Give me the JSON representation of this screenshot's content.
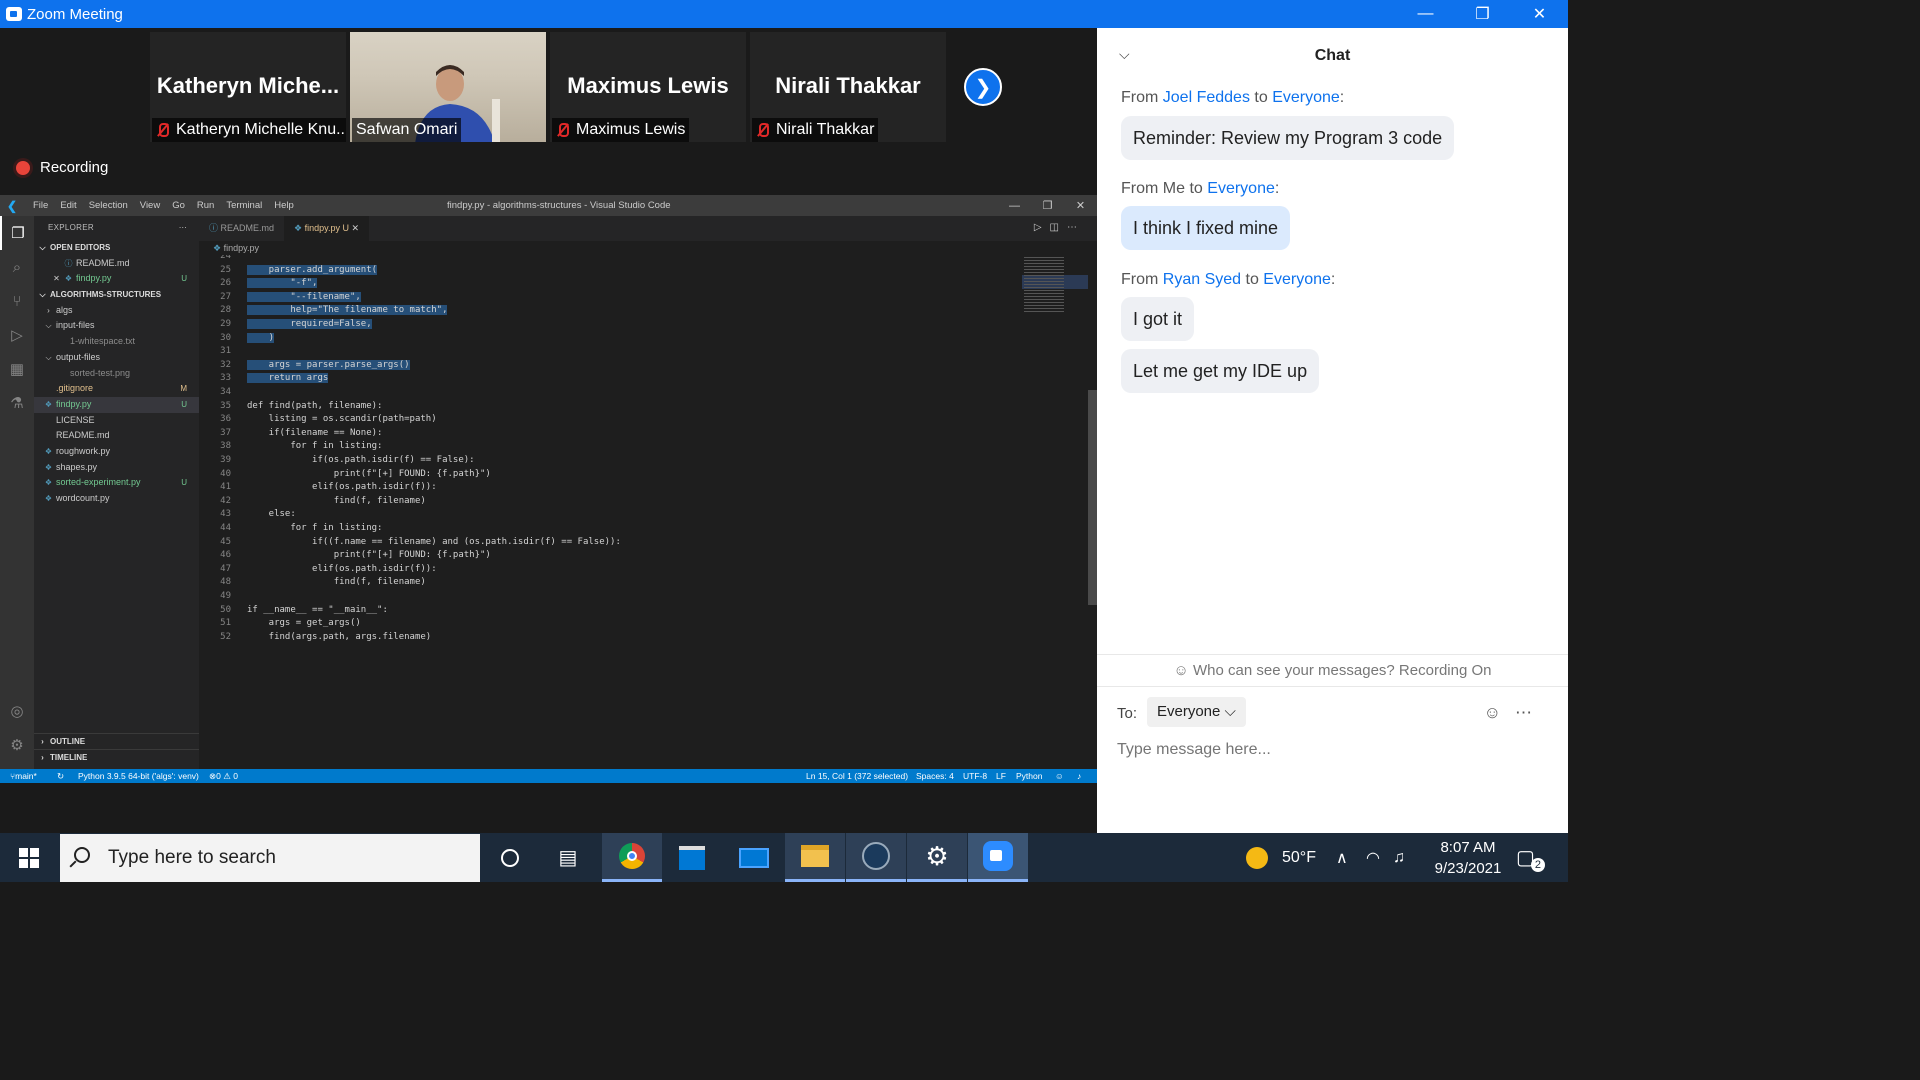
{
  "window": {
    "title": "Zoom Meeting"
  },
  "gallery": {
    "tiles": [
      {
        "big": "Katheryn  Miche...",
        "name": "Katheryn Michelle Knu..."
      },
      {
        "big": "",
        "name": "Safwan Omari"
      },
      {
        "big": "Maximus Lewis",
        "name": "Maximus Lewis"
      },
      {
        "big": "Nirali Thakkar",
        "name": "Nirali Thakkar"
      }
    ],
    "recording": "Recording"
  },
  "vscode": {
    "menu": [
      "File",
      "Edit",
      "Selection",
      "View",
      "Go",
      "Run",
      "Terminal",
      "Help"
    ],
    "title": "findpy.py - algorithms-structures - Visual Studio Code",
    "explorer_title": "EXPLORER",
    "open_editors": "OPEN EDITORS",
    "project": "ALGORITHMS-STRUCTURES",
    "outline": "OUTLINE",
    "timeline": "TIMELINE",
    "open_files": [
      {
        "name": "README.md",
        "status": ""
      },
      {
        "name": "findpy.py",
        "status": "U"
      }
    ],
    "files": [
      {
        "name": "algs",
        "status": "",
        "indent": 1,
        "type": "folder-closed"
      },
      {
        "name": "input-files",
        "status": "",
        "indent": 1,
        "type": "folder-open"
      },
      {
        "name": "1-whitespace.txt",
        "status": "",
        "indent": 2,
        "type": "file"
      },
      {
        "name": "output-files",
        "status": "",
        "indent": 1,
        "type": "folder-open"
      },
      {
        "name": "sorted-test.png",
        "status": "",
        "indent": 2,
        "type": "file"
      },
      {
        "name": ".gitignore",
        "status": "M",
        "indent": 1,
        "type": "file"
      },
      {
        "name": "findpy.py",
        "status": "U",
        "indent": 1,
        "type": "py"
      },
      {
        "name": "LICENSE",
        "status": "",
        "indent": 1,
        "type": "file"
      },
      {
        "name": "README.md",
        "status": "",
        "indent": 1,
        "type": "file"
      },
      {
        "name": "roughwork.py",
        "status": "",
        "indent": 1,
        "type": "py"
      },
      {
        "name": "shapes.py",
        "status": "",
        "indent": 1,
        "type": "py"
      },
      {
        "name": "sorted-experiment.py",
        "status": "U",
        "indent": 1,
        "type": "py"
      },
      {
        "name": "wordcount.py",
        "status": "",
        "indent": 1,
        "type": "py"
      }
    ],
    "tabs": [
      {
        "label": "README.md",
        "mod": ""
      },
      {
        "label": "findpy.py",
        "mod": "U"
      }
    ],
    "breadcrumb": "findpy.py",
    "code": [
      {
        "n": "24",
        "t": "",
        "sel": true
      },
      {
        "n": "25",
        "t": "    parser.add_argument(",
        "sel": true
      },
      {
        "n": "26",
        "t": "        \"-f\",",
        "sel": true
      },
      {
        "n": "27",
        "t": "        \"--filename\",",
        "sel": true
      },
      {
        "n": "28",
        "t": "        help=\"The filename to match\",",
        "sel": true
      },
      {
        "n": "29",
        "t": "        required=False,",
        "sel": true
      },
      {
        "n": "30",
        "t": "    )",
        "sel": true
      },
      {
        "n": "31",
        "t": "",
        "sel": true
      },
      {
        "n": "32",
        "t": "    args = parser.parse_args()",
        "sel": true
      },
      {
        "n": "33",
        "t": "    return args",
        "sel": true
      },
      {
        "n": "34",
        "t": "",
        "sel": false
      },
      {
        "n": "35",
        "t": "def find(path, filename):",
        "sel": false
      },
      {
        "n": "36",
        "t": "    listing = os.scandir(path=path)",
        "sel": false
      },
      {
        "n": "37",
        "t": "    if(filename == None):",
        "sel": false
      },
      {
        "n": "38",
        "t": "        for f in listing:",
        "sel": false
      },
      {
        "n": "39",
        "t": "            if(os.path.isdir(f) == False):",
        "sel": false
      },
      {
        "n": "40",
        "t": "                print(f\"[+] FOUND: {f.path}\")",
        "sel": false
      },
      {
        "n": "41",
        "t": "            elif(os.path.isdir(f)):",
        "sel": false
      },
      {
        "n": "42",
        "t": "                find(f, filename)",
        "sel": false
      },
      {
        "n": "43",
        "t": "    else:",
        "sel": false
      },
      {
        "n": "44",
        "t": "        for f in listing:",
        "sel": false
      },
      {
        "n": "45",
        "t": "            if((f.name == filename) and (os.path.isdir(f) == False)):",
        "sel": false
      },
      {
        "n": "46",
        "t": "                print(f\"[+] FOUND: {f.path}\")",
        "sel": false
      },
      {
        "n": "47",
        "t": "            elif(os.path.isdir(f)):",
        "sel": false
      },
      {
        "n": "48",
        "t": "                find(f, filename)",
        "sel": false
      },
      {
        "n": "49",
        "t": "",
        "sel": false
      },
      {
        "n": "50",
        "t": "if __name__ == \"__main__\":",
        "sel": false
      },
      {
        "n": "51",
        "t": "    args = get_args()",
        "sel": false
      },
      {
        "n": "52",
        "t": "    find(args.path, args.filename)",
        "sel": false
      }
    ],
    "status": {
      "branch": "main*",
      "python": "Python 3.9.5 64-bit ('algs': venv)",
      "problems": "0 ⚠ 0",
      "position": "Ln 15, Col 1 (372 selected)",
      "spaces": "Spaces: 4",
      "encoding": "UTF-8",
      "eol": "LF",
      "language": "Python"
    }
  },
  "chat": {
    "title": "Chat",
    "messages": [
      {
        "from": "Joel Feddes",
        "to": "Everyone",
        "bubbles": [
          "Reminder: Review my Program 3 code"
        ]
      },
      {
        "from": "Me",
        "to": "Everyone",
        "bubbles": [
          "I think I fixed mine"
        ]
      },
      {
        "from": "Ryan Syed",
        "to": "Everyone",
        "bubbles": [
          "I got it",
          "Let me get my IDE up"
        ]
      }
    ],
    "from_word": "From",
    "to_word": "to",
    "visibility": "Who can see your messages? Recording On",
    "to_label": "To:",
    "recipient": "Everyone",
    "placeholder": "Type message here..."
  },
  "taskbar": {
    "search_placeholder": "Type here to search",
    "weather": "50°F",
    "time": "8:07 AM",
    "date": "9/23/2021",
    "notifications": "2"
  },
  "colors": {
    "zoom_blue": "#0e72ed",
    "vscode_status": "#007acc",
    "selection": "#264f78"
  }
}
